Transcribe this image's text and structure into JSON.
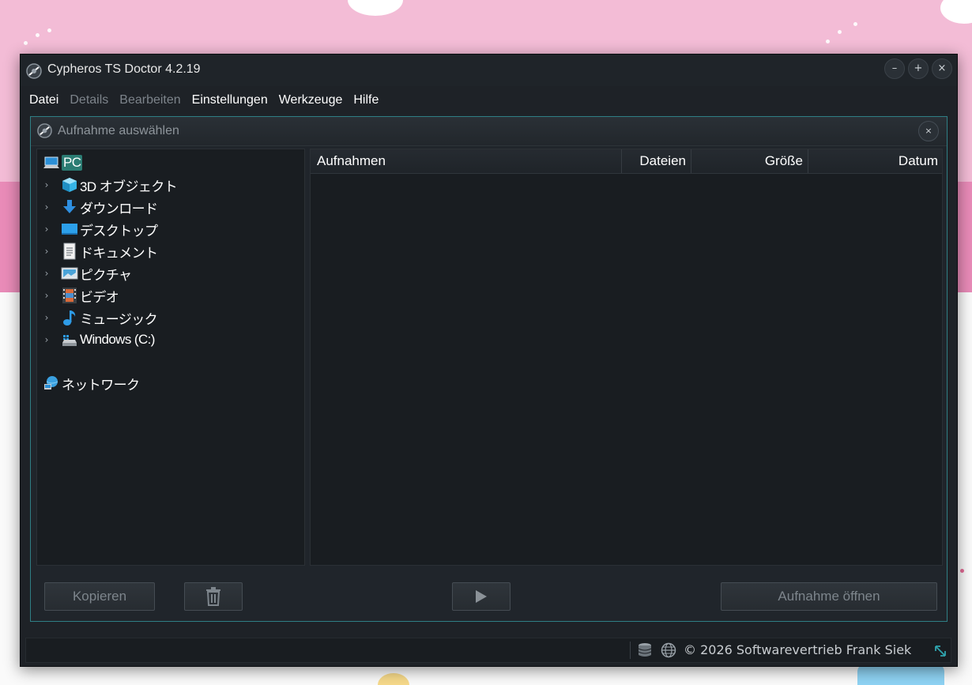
{
  "window": {
    "title": "Cypheros TS Doctor 4.2.19",
    "buttons": {
      "minimize": "–",
      "maximize": "+",
      "close": "×"
    }
  },
  "menu": [
    {
      "label": "Datei",
      "enabled": true
    },
    {
      "label": "Details",
      "enabled": false
    },
    {
      "label": "Bearbeiten",
      "enabled": false
    },
    {
      "label": "Einstellungen",
      "enabled": true
    },
    {
      "label": "Werkzeuge",
      "enabled": true
    },
    {
      "label": "Hilfe",
      "enabled": true
    }
  ],
  "dialog": {
    "title": "Aufnahme auswählen",
    "close": "×"
  },
  "tree": {
    "root": {
      "label": "PC",
      "icon": "pc-icon"
    },
    "items": [
      {
        "label": "3D オブジェクト",
        "icon": "3d-objects-icon"
      },
      {
        "label": "ダウンロード",
        "icon": "download-icon"
      },
      {
        "label": "デスクトップ",
        "icon": "desktop-icon"
      },
      {
        "label": "ドキュメント",
        "icon": "document-icon"
      },
      {
        "label": "ピクチャ",
        "icon": "pictures-icon"
      },
      {
        "label": "ビデオ",
        "icon": "video-icon"
      },
      {
        "label": "ミュージック",
        "icon": "music-icon"
      },
      {
        "label": "Windows (C:)",
        "icon": "drive-icon"
      }
    ],
    "network": {
      "label": "ネットワーク",
      "icon": "network-icon"
    }
  },
  "list": {
    "columns": [
      "Aufnahmen",
      "Dateien",
      "Größe",
      "Datum"
    ],
    "rows": []
  },
  "buttons": {
    "copy": "Kopieren",
    "delete_icon": "trash-icon",
    "play_icon": "play-icon",
    "open": "Aufnahme öffnen"
  },
  "status": {
    "copyright": "© 2026 Softwarevertrieb Frank Siek"
  },
  "colors": {
    "accent": "#2f7f85",
    "selection": "#2b7c73",
    "background": "#1e2227"
  }
}
